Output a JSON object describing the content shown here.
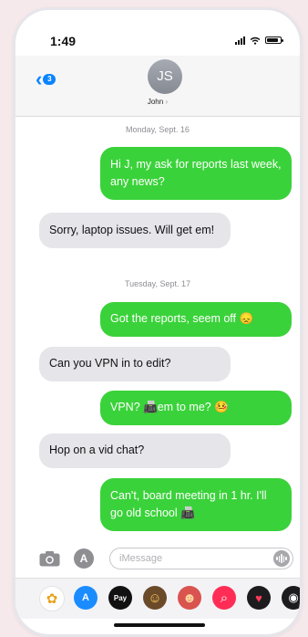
{
  "status_bar": {
    "time": "1:49"
  },
  "header": {
    "back_badge_count": "3",
    "contact_initials": "JS",
    "contact_name": "John",
    "contact_chevron": "›"
  },
  "conversation": {
    "date_1": "Monday, Sept. 16",
    "date_2": "Tuesday, Sept. 17",
    "messages": [
      {
        "direction": "sent",
        "text": "Hi J, my ask for reports last week, any news?"
      },
      {
        "direction": "received",
        "text": "Sorry, laptop issues. Will get em!"
      },
      {
        "direction": "sent",
        "text": "Got the reports, seem off 😞"
      },
      {
        "direction": "received",
        "text": "Can you VPN in to edit?"
      },
      {
        "direction": "sent",
        "text": "VPN? 📠em to me? 🤒"
      },
      {
        "direction": "received",
        "text": "Hop on a vid chat?"
      },
      {
        "direction": "sent",
        "text": "Can't, board meeting in 1 hr. I'll go old school 📠"
      }
    ]
  },
  "input_bar": {
    "placeholder": "iMessage",
    "value": ""
  },
  "app_tray": [
    {
      "name": "photos-app-icon",
      "glyph": "✿",
      "color": "#ffffff"
    },
    {
      "name": "appstore-app-icon",
      "glyph": "A",
      "color": "#1a8cff"
    },
    {
      "name": "apple-pay-app-icon",
      "glyph": "Pay",
      "color": "#111111"
    },
    {
      "name": "memoji-app-icon",
      "glyph": "☺",
      "color": "#6b4a2a"
    },
    {
      "name": "animoji-app-icon",
      "glyph": "☻",
      "color": "#d9534f"
    },
    {
      "name": "search-images-app-icon",
      "glyph": "⌕",
      "color": "#ff2d55"
    },
    {
      "name": "digital-touch-app-icon",
      "glyph": "♥",
      "color": "#1c1c1e"
    },
    {
      "name": "more-apps-icon",
      "glyph": "◉",
      "color": "#1c1c1e"
    }
  ],
  "colors": {
    "sent_bubble": "#3ad23a",
    "received_bubble": "#e5e5ea",
    "accent": "#0a84ff"
  }
}
